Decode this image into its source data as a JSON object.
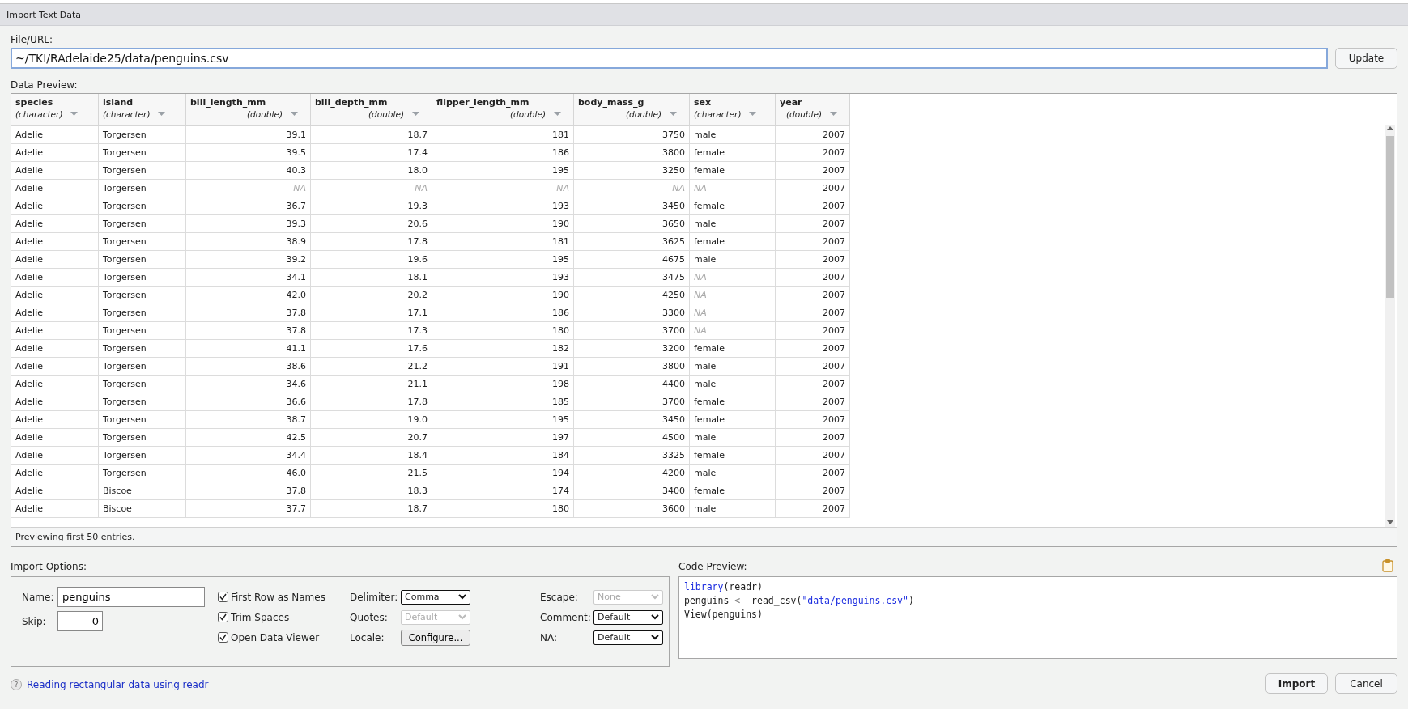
{
  "window": {
    "title": "Import Text Data"
  },
  "file": {
    "label": "File/URL:",
    "value": "~/TKI/RAdelaide25/data/penguins.csv",
    "update_button": "Update"
  },
  "preview": {
    "label": "Data Preview:",
    "footer": "Previewing first 50 entries.",
    "columns": [
      {
        "name": "species",
        "type": "(character)",
        "numeric": false
      },
      {
        "name": "island",
        "type": "(character)",
        "numeric": false
      },
      {
        "name": "bill_length_mm",
        "type": "(double)",
        "numeric": true
      },
      {
        "name": "bill_depth_mm",
        "type": "(double)",
        "numeric": true
      },
      {
        "name": "flipper_length_mm",
        "type": "(double)",
        "numeric": true
      },
      {
        "name": "body_mass_g",
        "type": "(double)",
        "numeric": true
      },
      {
        "name": "sex",
        "type": "(character)",
        "numeric": false
      },
      {
        "name": "year",
        "type": "(double)",
        "numeric": true
      }
    ],
    "rows": [
      {
        "cells": [
          "Adelie",
          "Torgersen",
          "39.1",
          "18.7",
          "181",
          "3750",
          "male",
          "2007"
        ]
      },
      {
        "cells": [
          "Adelie",
          "Torgersen",
          "39.5",
          "17.4",
          "186",
          "3800",
          "female",
          "2007"
        ]
      },
      {
        "cells": [
          "Adelie",
          "Torgersen",
          "40.3",
          "18.0",
          "195",
          "3250",
          "female",
          "2007"
        ]
      },
      {
        "cells": [
          "Adelie",
          "Torgersen",
          "NA",
          "NA",
          "NA",
          "NA",
          "NA",
          "2007"
        ],
        "missing": [
          false,
          false,
          true,
          true,
          true,
          true,
          true,
          false
        ]
      },
      {
        "cells": [
          "Adelie",
          "Torgersen",
          "36.7",
          "19.3",
          "193",
          "3450",
          "female",
          "2007"
        ]
      },
      {
        "cells": [
          "Adelie",
          "Torgersen",
          "39.3",
          "20.6",
          "190",
          "3650",
          "male",
          "2007"
        ]
      },
      {
        "cells": [
          "Adelie",
          "Torgersen",
          "38.9",
          "17.8",
          "181",
          "3625",
          "female",
          "2007"
        ]
      },
      {
        "cells": [
          "Adelie",
          "Torgersen",
          "39.2",
          "19.6",
          "195",
          "4675",
          "male",
          "2007"
        ]
      },
      {
        "cells": [
          "Adelie",
          "Torgersen",
          "34.1",
          "18.1",
          "193",
          "3475",
          "NA",
          "2007"
        ],
        "missing": [
          false,
          false,
          false,
          false,
          false,
          false,
          true,
          false
        ]
      },
      {
        "cells": [
          "Adelie",
          "Torgersen",
          "42.0",
          "20.2",
          "190",
          "4250",
          "NA",
          "2007"
        ],
        "missing": [
          false,
          false,
          false,
          false,
          false,
          false,
          true,
          false
        ]
      },
      {
        "cells": [
          "Adelie",
          "Torgersen",
          "37.8",
          "17.1",
          "186",
          "3300",
          "NA",
          "2007"
        ],
        "missing": [
          false,
          false,
          false,
          false,
          false,
          false,
          true,
          false
        ]
      },
      {
        "cells": [
          "Adelie",
          "Torgersen",
          "37.8",
          "17.3",
          "180",
          "3700",
          "NA",
          "2007"
        ],
        "missing": [
          false,
          false,
          false,
          false,
          false,
          false,
          true,
          false
        ]
      },
      {
        "cells": [
          "Adelie",
          "Torgersen",
          "41.1",
          "17.6",
          "182",
          "3200",
          "female",
          "2007"
        ]
      },
      {
        "cells": [
          "Adelie",
          "Torgersen",
          "38.6",
          "21.2",
          "191",
          "3800",
          "male",
          "2007"
        ]
      },
      {
        "cells": [
          "Adelie",
          "Torgersen",
          "34.6",
          "21.1",
          "198",
          "4400",
          "male",
          "2007"
        ]
      },
      {
        "cells": [
          "Adelie",
          "Torgersen",
          "36.6",
          "17.8",
          "185",
          "3700",
          "female",
          "2007"
        ]
      },
      {
        "cells": [
          "Adelie",
          "Torgersen",
          "38.7",
          "19.0",
          "195",
          "3450",
          "female",
          "2007"
        ]
      },
      {
        "cells": [
          "Adelie",
          "Torgersen",
          "42.5",
          "20.7",
          "197",
          "4500",
          "male",
          "2007"
        ]
      },
      {
        "cells": [
          "Adelie",
          "Torgersen",
          "34.4",
          "18.4",
          "184",
          "3325",
          "female",
          "2007"
        ]
      },
      {
        "cells": [
          "Adelie",
          "Torgersen",
          "46.0",
          "21.5",
          "194",
          "4200",
          "male",
          "2007"
        ]
      },
      {
        "cells": [
          "Adelie",
          "Biscoe",
          "37.8",
          "18.3",
          "174",
          "3400",
          "female",
          "2007"
        ]
      },
      {
        "cells": [
          "Adelie",
          "Biscoe",
          "37.7",
          "18.7",
          "180",
          "3600",
          "male",
          "2007"
        ]
      }
    ]
  },
  "import_options": {
    "label": "Import Options:",
    "name": {
      "label": "Name:",
      "value": "penguins"
    },
    "skip": {
      "label": "Skip:",
      "value": "0"
    },
    "checkboxes": [
      {
        "label": "First Row as Names",
        "checked": true
      },
      {
        "label": "Trim Spaces",
        "checked": true
      },
      {
        "label": "Open Data Viewer",
        "checked": true
      }
    ],
    "settings": [
      {
        "label": "Delimiter:",
        "kind": "select",
        "value": "Comma",
        "disabled": false
      },
      {
        "label": "Quotes:",
        "kind": "select",
        "value": "Default",
        "disabled": true
      },
      {
        "label": "Locale:",
        "kind": "button",
        "value": "Configure..."
      },
      {
        "label": "Escape:",
        "kind": "select",
        "value": "None",
        "disabled": true
      },
      {
        "label": "Comment:",
        "kind": "select",
        "value": "Default",
        "disabled": false
      },
      {
        "label": "NA:",
        "kind": "select",
        "value": "Default",
        "disabled": false
      }
    ]
  },
  "code_preview": {
    "label": "Code Preview:",
    "lines": [
      [
        {
          "text": "library",
          "kind": "function"
        },
        {
          "text": "(readr)",
          "kind": "plain"
        }
      ],
      [
        {
          "text": "penguins ",
          "kind": "plain"
        },
        {
          "text": "<-",
          "kind": "operator"
        },
        {
          "text": " read_csv(",
          "kind": "plain"
        },
        {
          "text": "\"data/penguins.csv\"",
          "kind": "string"
        },
        {
          "text": ")",
          "kind": "plain"
        }
      ],
      [
        {
          "text": "View(penguins)",
          "kind": "plain"
        }
      ]
    ]
  },
  "help": {
    "icon": "?",
    "link": "Reading rectangular data using readr"
  },
  "buttons": [
    {
      "label": "Import",
      "primary": true
    },
    {
      "label": "Cancel",
      "primary": false
    }
  ]
}
